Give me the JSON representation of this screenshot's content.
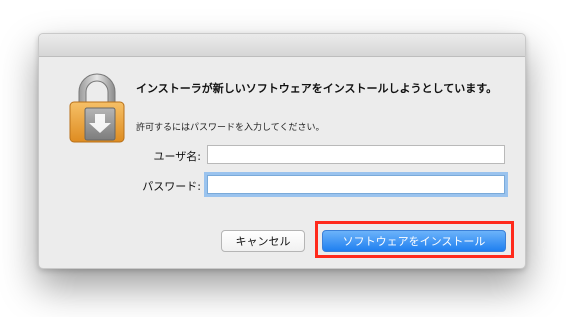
{
  "dialog": {
    "title": "インストーラが新しいソフトウェアをインストールしようとしています。",
    "subtitle": "許可するにはパスワードを入力してください。",
    "icon": "lock-icon"
  },
  "fields": {
    "username_label": "ユーザ名:",
    "username_value": "",
    "password_label": "パスワード:",
    "password_value": ""
  },
  "buttons": {
    "cancel": "キャンセル",
    "install": "ソフトウェアをインストール"
  },
  "colors": {
    "accent": "#1f7ff0",
    "highlight": "#ff2a1c"
  }
}
